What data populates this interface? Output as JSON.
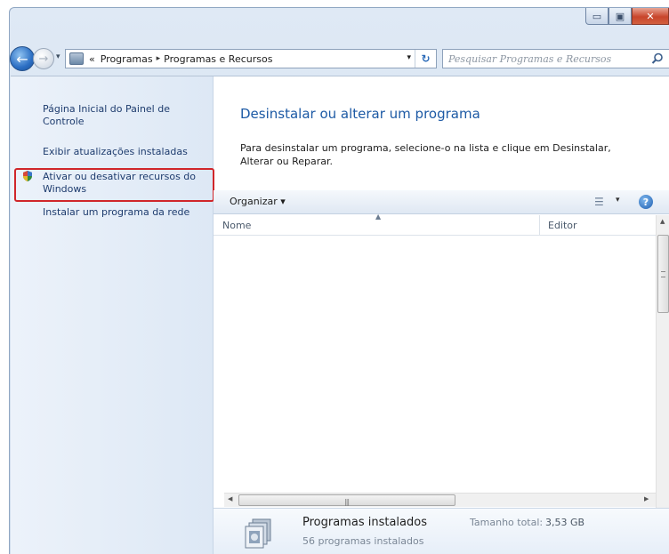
{
  "window": {
    "caption": {
      "minimize": "▭",
      "maximize": "▣",
      "close": "✕"
    }
  },
  "nav": {
    "back": "←",
    "forward": "→",
    "history_dropdown": "▾",
    "address": {
      "overflow": "«",
      "segments": [
        "Programas",
        "Programas e Recursos"
      ],
      "separator": "▸",
      "dropdown": "▾",
      "refresh": "↻"
    },
    "search": {
      "placeholder": "Pesquisar Programas e Recursos"
    }
  },
  "left_pane": {
    "links": [
      "Página Inicial do Painel de Controle",
      "Exibir atualizações instaladas",
      "Ativar ou desativar recursos do Windows",
      "Instalar um programa da rede"
    ],
    "highlight_color": "#d0262a"
  },
  "main": {
    "title": "Desinstalar ou alterar um programa",
    "description": "Para desinstalar um programa, selecione-o na lista e clique em Desinstalar, Alterar ou Reparar."
  },
  "toolbar": {
    "organize": "Organizar ▾",
    "views_icon": "☰",
    "views_dropdown": "▾",
    "help": "?"
  },
  "list": {
    "columns": [
      "Nome",
      "Editor"
    ],
    "rows": []
  },
  "details": {
    "title": "Programas instalados",
    "size_label": "Tamanho total:",
    "size_value": "3,53 GB",
    "count": "56 programas instalados"
  },
  "colors": {
    "title_blue": "#1d5aa5",
    "link_blue": "#1e3c6e",
    "close_red": "#c8452c"
  }
}
